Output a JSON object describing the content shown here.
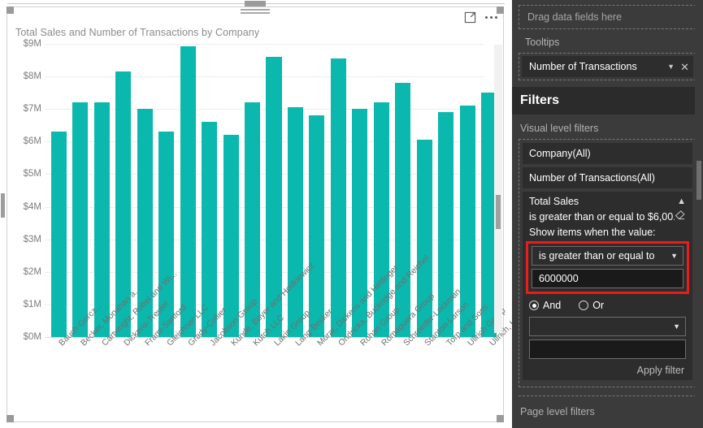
{
  "visual": {
    "title": "Total Sales and Number of Transactions by Company",
    "focus_icon": "focus-mode-icon",
    "more_icon": "more-options-icon"
  },
  "chart_data": {
    "type": "bar",
    "title": "Total Sales and Number of Transactions by Company",
    "xlabel": "",
    "ylabel": "",
    "ylim": [
      0,
      9000000
    ],
    "grid": true,
    "legend": "none",
    "bar_color": "#0bb8ad",
    "ytick_labels": [
      "$9M",
      "$8M",
      "$7M",
      "$6M",
      "$5M",
      "$4M",
      "$3M",
      "$2M",
      "$1M",
      "$0M"
    ],
    "ytick_values": [
      9000000,
      8000000,
      7000000,
      6000000,
      5000000,
      4000000,
      3000000,
      2000000,
      1000000,
      0
    ],
    "categories": [
      "Bauch-Gorcz...",
      "Becker, Monahan a...",
      "Cartwright, Robel and Wi...",
      "Dickens-Treutel",
      "Frami-Sanford",
      "Gleichner LLC",
      "Grady-Collier",
      "Jacobson Group",
      "Kunde, Boyer and Hodkiewicz",
      "Kutch LLC",
      "Lakin Group",
      "Lang-Becker",
      "Morar, Dickens and Hettinger",
      "Ondricka, Buckridge and Reichel",
      "Rohan Group",
      "Romaguera Group",
      "Schroeder-Lockman",
      "Stanton-Larson",
      "Torp and Sons",
      "Ullrich Group",
      "Ullrich, Hodkiewicz and Shanahan"
    ],
    "values": [
      6300000,
      7200000,
      7200000,
      8150000,
      7000000,
      6300000,
      8920000,
      6600000,
      6200000,
      7200000,
      8600000,
      7050000,
      6800000,
      8550000,
      7000000,
      7200000,
      7800000,
      6050000,
      6900000,
      7100000,
      7500000
    ]
  },
  "pane": {
    "dropzone_placeholder": "Drag data fields here",
    "tooltips_label": "Tooltips",
    "tooltips_field": "Number of Transactions",
    "tooltips_chevron": "chevron-down-icon",
    "tooltips_remove": "remove-field-icon",
    "filters_title": "Filters",
    "visual_level_label": "Visual level filters",
    "filters": [
      {
        "name": "Company(All)"
      },
      {
        "name": "Number of Transactions(All)"
      }
    ],
    "active_filter": {
      "title": "Total Sales",
      "summary": "is greater than or equal to $6,00...",
      "collapse_icon": "chevron-up-icon",
      "clear_icon": "eraser-icon",
      "prompt": "Show items when the value:",
      "condition": "is greater than or equal to",
      "condition_caret": "chevron-down-icon",
      "value": "6000000",
      "and_label": "And",
      "or_label": "Or",
      "and_selected": true,
      "second_condition": "",
      "second_condition_caret": "chevron-down-icon",
      "second_value": "",
      "apply_label": "Apply filter",
      "highlight_color": "#ef1b1b"
    },
    "page_level_label": "Page level filters"
  }
}
